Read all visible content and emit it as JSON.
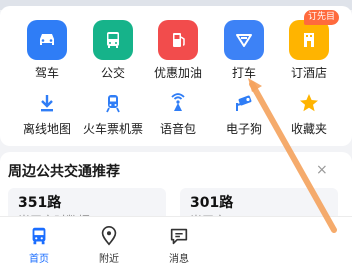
{
  "colors": {
    "accent": "#1a6dff",
    "car_tile": "#2f7df6",
    "bus_tile": "#16b38a",
    "fuel_tile": "#f24c4c",
    "taxi_tile": "#3d82f6",
    "hotel_tile": "#ffb400",
    "arrow": "#f5a25d"
  },
  "grid": {
    "row1": [
      {
        "label": "驾车",
        "icon": "car-icon"
      },
      {
        "label": "公交",
        "icon": "bus-icon"
      },
      {
        "label": "优惠加油",
        "icon": "fuel-pump-icon"
      },
      {
        "label": "打车",
        "icon": "taxi-icon"
      },
      {
        "label": "订酒店",
        "icon": "hotel-icon"
      }
    ],
    "row2": [
      {
        "label": "离线地图",
        "icon": "download-icon"
      },
      {
        "label": "火车票机票",
        "icon": "train-icon"
      },
      {
        "label": "语音包",
        "icon": "voice-broadcast-icon"
      },
      {
        "label": "电子狗",
        "icon": "speed-camera-icon"
      },
      {
        "label": "收藏夹",
        "icon": "star-icon"
      }
    ],
    "hotel_badge": "订先目"
  },
  "transit": {
    "title": "周边公共交通推荐",
    "close": "×",
    "routes": [
      {
        "name": "351路",
        "status": "尚无实时数据"
      },
      {
        "name": "301路",
        "status": "尚无实"
      }
    ]
  },
  "nav": {
    "items": [
      {
        "label": "首页",
        "icon": "home-bus-icon",
        "active": true
      },
      {
        "label": "附近",
        "icon": "location-pin-icon",
        "active": false
      },
      {
        "label": "消息",
        "icon": "message-icon",
        "active": false
      }
    ]
  }
}
